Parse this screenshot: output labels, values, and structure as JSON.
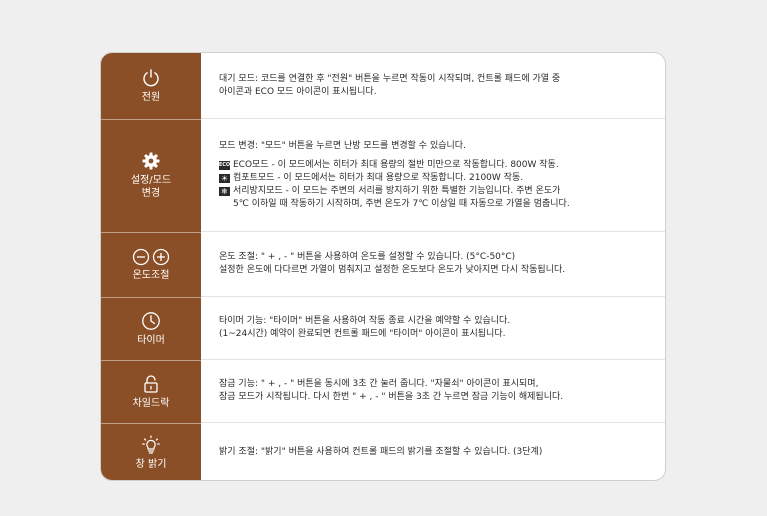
{
  "rows": [
    {
      "label": "전원",
      "icon": "power-icon",
      "lines": [
        "대기 모드: 코드를 연결한 후 \"전원\" 버튼을 누르면 작동이 시작되며, 컨트롤 패드에 가열 중",
        "아이콘과 ECO 모드 아이콘이 표시됩니다."
      ]
    },
    {
      "label_line1": "설정/모드",
      "label_line2": "변경",
      "icon": "gear-icon",
      "intro": "모드 변경: \"모드\" 버튼을 누르면 난방 모드를 변경할 수 있습니다.",
      "modes": [
        {
          "badge": "ECO",
          "text": "ECO모드 - 이 모드에서는 히터가 최대 용량의 절반 미만으로 작동합니다. 800W 작동."
        },
        {
          "badge": "☀",
          "text": "컴포트모드 - 이 모드에서는 히터가 최대 용량으로 작동합니다. 2100W 작동."
        },
        {
          "badge": "❄",
          "text": "서리방지모드 - 이 모드는 주변의 서리를 방지하기 위한 특별한 기능입니다. 주변 온도가",
          "cont": "5℃ 이하일 때 작동하기 시작하며, 주변 온도가 7℃ 이상일 때 자동으로 가열을 멈춥니다."
        }
      ]
    },
    {
      "label": "온도조절",
      "icon": "minus-plus-icon",
      "lines": [
        "온도 조절: \" + , - \" 버튼을 사용하여 온도를 설정할 수 있습니다. (5°C-50°C)",
        "설정한 온도에 다다르면 가열이 멈춰지고 설정한 온도보다 온도가 낮아지면 다시 작동됩니다."
      ]
    },
    {
      "label": "타이머",
      "icon": "clock-icon",
      "lines": [
        "타이머 기능: \"타이머\" 버튼을 사용하여 작동 종료 시간을 예약할 수 있습니다.",
        "(1~24시간) 예약이 완료되면 컨트롤 패드에 \"타이머\" 아이콘이 표시됩니다."
      ]
    },
    {
      "label": "차일드락",
      "icon": "lock-icon",
      "lines": [
        "잠금 기능: \" + , - \" 버튼을 동시에 3초 간 눌러 줍니다. \"자물쇠\" 아이콘이 표시되며,",
        "잠금 모드가 시작됩니다. 다시 한번 \" + , - \" 버튼을 3초 간 누르면 잠금 기능이 해제됩니다."
      ]
    },
    {
      "label": "창 밝기",
      "icon": "light-bulb-icon",
      "lines": [
        "밝기 조절: \"밝기\" 버튼을 사용하여 컨트롤 패드의 밝기를 조절할 수 있습니다. (3단계)"
      ]
    }
  ],
  "colors": {
    "sidebar": "#8b4f27",
    "page_bg": "#efefef",
    "text": "#2a2a2a"
  }
}
